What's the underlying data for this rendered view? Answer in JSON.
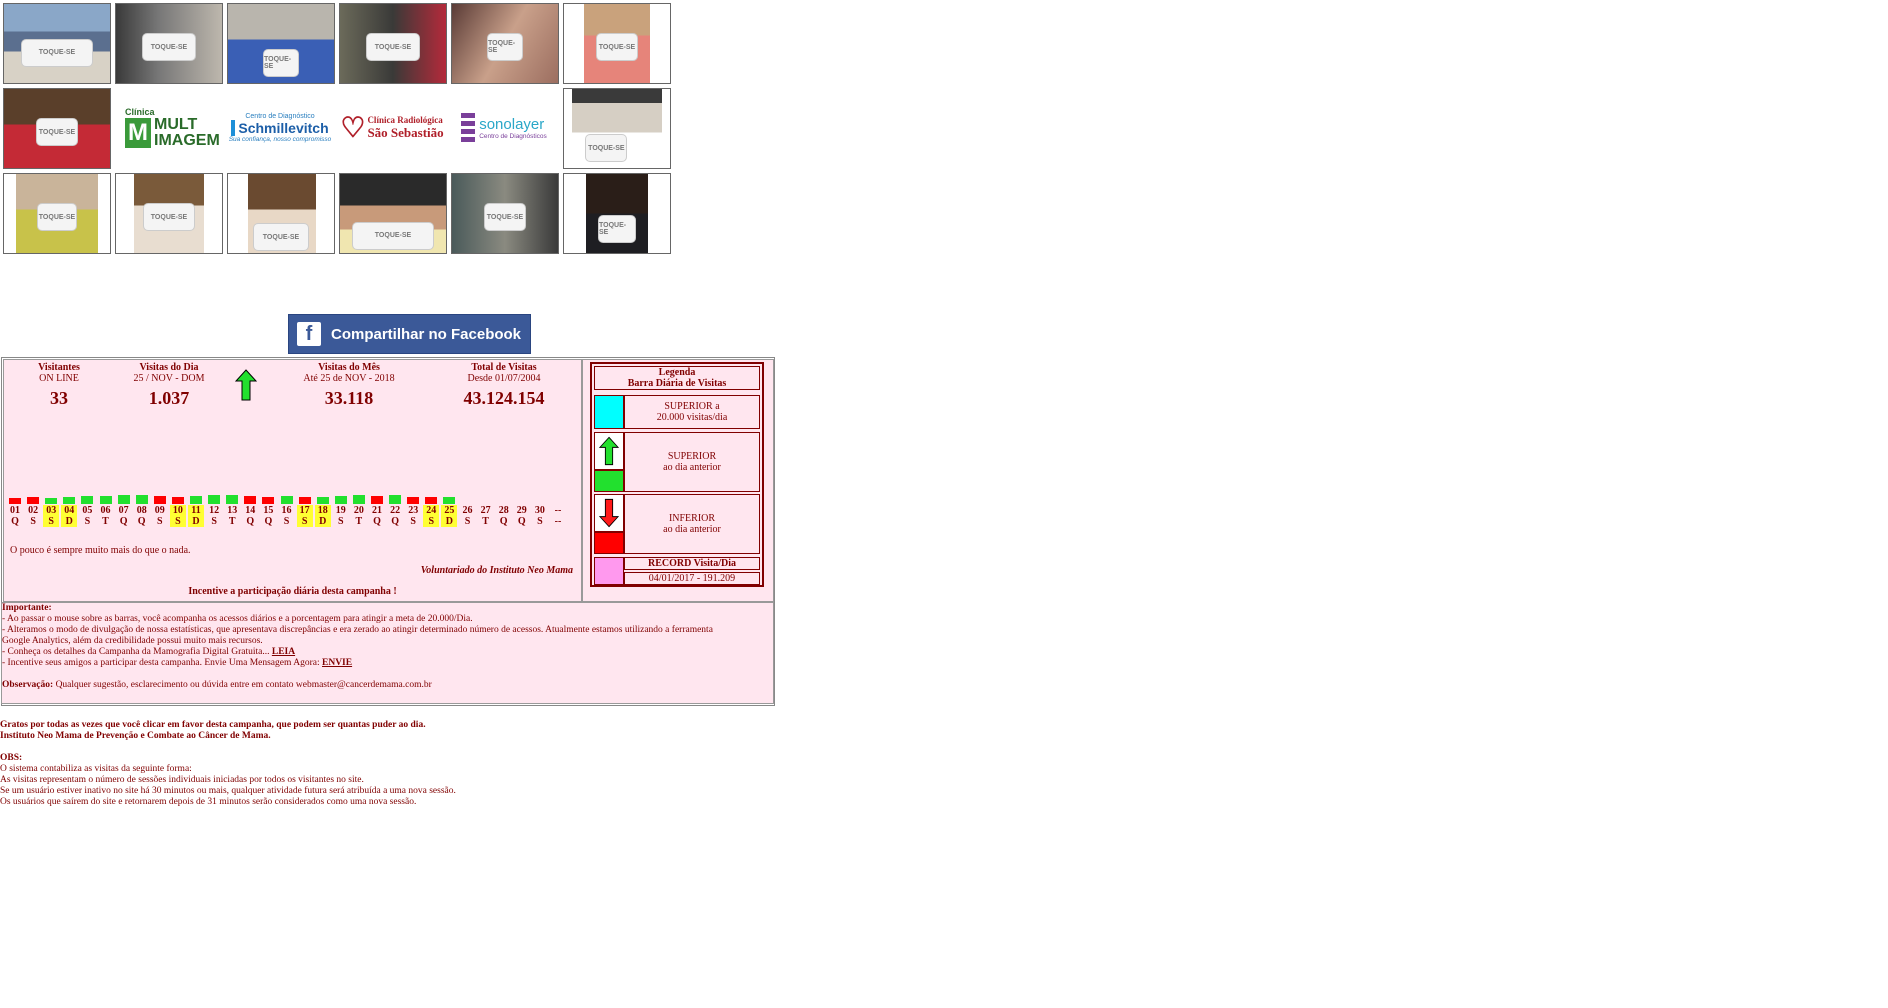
{
  "share_button": {
    "label": "Compartilhar no Facebook"
  },
  "logos": {
    "multimagem": {
      "line1": "Clínica",
      "line2": "MULT",
      "line3": "IMAGEM"
    },
    "schmillevitch": {
      "top": "Centro de Diagnóstico",
      "name": "Schmillevitch",
      "tagline": "Sua confiança, nosso compromisso"
    },
    "sao_sebastiao": {
      "line1": "Clínica Radiológica",
      "line2": "São Sebastião"
    },
    "sonolayer": {
      "name": "sonolayer",
      "tagline": "Centro de Diagnósticos"
    }
  },
  "photo_caption": "TOQUE-SE",
  "stats": {
    "online": {
      "title": "Visitantes",
      "sub": "ON LINE",
      "value": "33"
    },
    "today": {
      "title": "Visitas do Dia",
      "sub": "25 / NOV - DOM",
      "value": "1.037"
    },
    "month": {
      "title": "Visitas do Mês",
      "sub": "Até 25 de NOV - 2018",
      "value": "33.118"
    },
    "total": {
      "title": "Total de Visitas",
      "sub": "Desde 01/07/2004",
      "value": "43.124.154"
    }
  },
  "colors": {
    "up": "#22e02e",
    "down": "#ff0000",
    "weekend": "#ffff33",
    "cyan": "#00ffff",
    "record": "#ff99ee"
  },
  "days": [
    {
      "n": "01",
      "w": "Q",
      "t": "down",
      "wk": false
    },
    {
      "n": "02",
      "w": "S",
      "t": "down",
      "wk": false
    },
    {
      "n": "03",
      "w": "S",
      "t": "up",
      "wk": true
    },
    {
      "n": "04",
      "w": "D",
      "t": "up",
      "wk": true
    },
    {
      "n": "05",
      "w": "S",
      "t": "up",
      "wk": false
    },
    {
      "n": "06",
      "w": "T",
      "t": "up",
      "wk": false
    },
    {
      "n": "07",
      "w": "Q",
      "t": "up",
      "wk": false
    },
    {
      "n": "08",
      "w": "Q",
      "t": "up",
      "wk": false
    },
    {
      "n": "09",
      "w": "S",
      "t": "down",
      "wk": false
    },
    {
      "n": "10",
      "w": "S",
      "t": "down",
      "wk": true
    },
    {
      "n": "11",
      "w": "D",
      "t": "up",
      "wk": true
    },
    {
      "n": "12",
      "w": "S",
      "t": "up",
      "wk": false
    },
    {
      "n": "13",
      "w": "T",
      "t": "up",
      "wk": false
    },
    {
      "n": "14",
      "w": "Q",
      "t": "down",
      "wk": false
    },
    {
      "n": "15",
      "w": "Q",
      "t": "down",
      "wk": false
    },
    {
      "n": "16",
      "w": "S",
      "t": "up",
      "wk": false
    },
    {
      "n": "17",
      "w": "S",
      "t": "down",
      "wk": true
    },
    {
      "n": "18",
      "w": "D",
      "t": "up",
      "wk": true
    },
    {
      "n": "19",
      "w": "S",
      "t": "up",
      "wk": false
    },
    {
      "n": "20",
      "w": "T",
      "t": "up",
      "wk": false
    },
    {
      "n": "21",
      "w": "Q",
      "t": "down",
      "wk": false
    },
    {
      "n": "22",
      "w": "Q",
      "t": "up",
      "wk": false
    },
    {
      "n": "23",
      "w": "S",
      "t": "down",
      "wk": false
    },
    {
      "n": "24",
      "w": "S",
      "t": "down",
      "wk": true
    },
    {
      "n": "25",
      "w": "D",
      "t": "up",
      "wk": true
    },
    {
      "n": "26",
      "w": "S",
      "t": "none",
      "wk": false
    },
    {
      "n": "27",
      "w": "T",
      "t": "none",
      "wk": false
    },
    {
      "n": "28",
      "w": "Q",
      "t": "none",
      "wk": false
    },
    {
      "n": "29",
      "w": "Q",
      "t": "none",
      "wk": false
    },
    {
      "n": "30",
      "w": "S",
      "t": "none",
      "wk": false
    },
    {
      "n": "--",
      "w": "--",
      "t": "none",
      "wk": false
    }
  ],
  "quote": "O pouco é sempre muito mais do que o nada.",
  "signature": "Voluntariado do Instituto Neo Mama",
  "encourage": "Incentive a participação diária desta campanha !",
  "legend": {
    "title1": "Legenda",
    "title2": "Barra Diária de Visitas",
    "superior_meta1": "SUPERIOR a",
    "superior_meta2": "20.000 visitas/dia",
    "superior1": "SUPERIOR",
    "superior2": "ao dia anterior",
    "inferior1": "INFERIOR",
    "inferior2": "ao dia anterior",
    "record_title": "RECORD Visita/Dia",
    "record_value": "04/01/2017 - 191.209"
  },
  "notes": {
    "heading": "Importante:",
    "l1": "- Ao passar o mouse sobre as barras, você acompanha os acessos diários e a porcentagem para atingir a meta de 20.000/Dia.",
    "l2": "- Alteramos o modo de divulgação de nossa estatísticas, que apresentava discrepâncias e era zerado ao atingir determinado número de acessos. Atualmente estamos utilizando a ferramenta",
    "l3": "Google Analytics, além da credibilidade possui muito mais recursos.",
    "l4": "- Conheça os detalhes da Campanha da Mamografia Digital Gratuita... ",
    "l4_link": "LEIA",
    "l5": "- Incentive seus amigos a participar desta campanha. Envie Uma Mensagem Agora: ",
    "l5_link": "ENVIE",
    "obs_label": "Observação:",
    "obs_text": " Qualquer sugestão, esclarecimento ou dúvida entre em contato  webmaster@cancerdemama.com.br"
  },
  "footer": {
    "thanks1": "Gratos por todas as vezes que você clicar em favor desta campanha, que podem ser quantas puder ao dia.",
    "thanks2": "Instituto Neo Mama de Prevenção e Combate ao Câncer de Mama.",
    "obs": "OBS:",
    "f1": "O sistema contabiliza as visitas da seguinte forma:",
    "f2": "As visitas representam o número de sessões individuais iniciadas por todos os visitantes no site.",
    "f3": "Se um usuário estiver inativo no site há 30 minutos ou mais, qualquer atividade futura será atribuída a uma nova sessão.",
    "f4": "Os usuários que saírem do site e retornarem depois de 31 minutos serão considerados como uma nova sessão."
  }
}
